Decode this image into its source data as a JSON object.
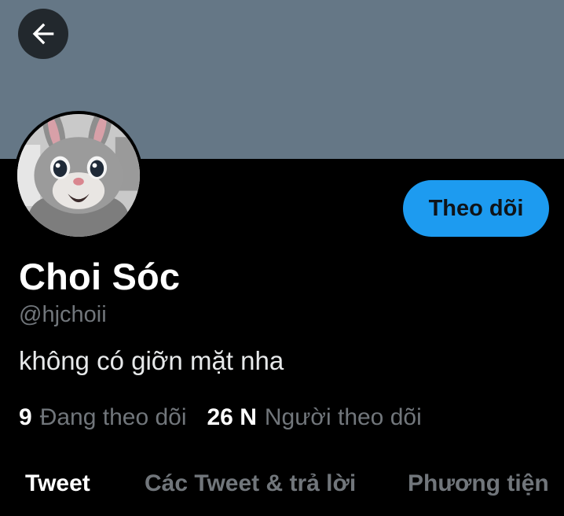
{
  "colors": {
    "banner": "#657786",
    "accent": "#1d9bf0",
    "muted": "#71767b"
  },
  "header": {
    "back_icon": "arrow-left-icon"
  },
  "profile": {
    "avatar_icon": "bunny-mascot-avatar",
    "follow_label": "Theo dõi",
    "display_name": "Choi Sóc",
    "handle": "@hjchoii",
    "bio": "không có giỡn mặt nha"
  },
  "stats": {
    "following_count": "9",
    "following_label": "Đang theo dõi",
    "followers_count": "26 N",
    "followers_label": "Người theo dõi"
  },
  "tabs": [
    {
      "label": "Tweet",
      "active": true
    },
    {
      "label": "Các Tweet & trả lời",
      "active": false
    },
    {
      "label": "Phương tiện",
      "active": false
    }
  ]
}
